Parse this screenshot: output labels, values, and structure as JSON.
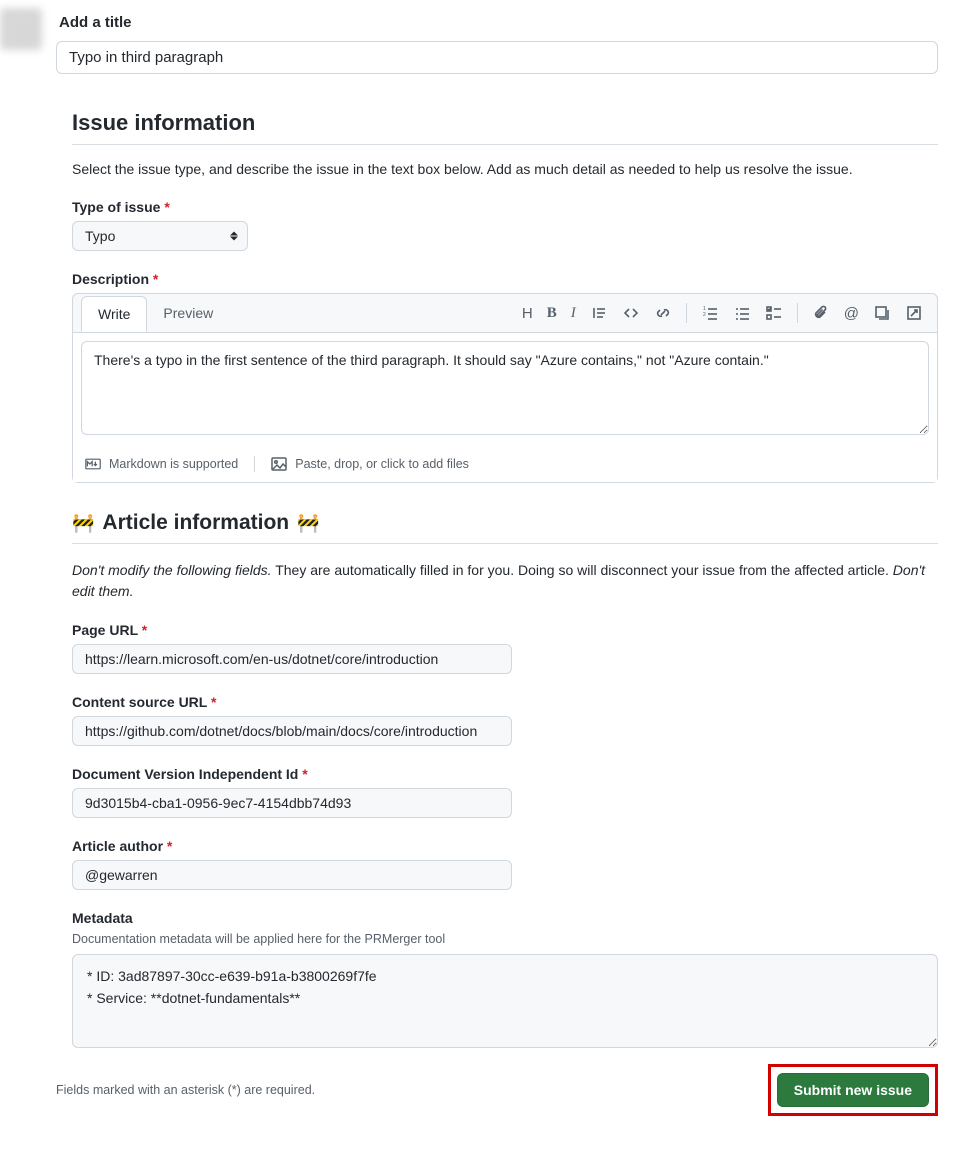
{
  "title_section": {
    "label": "Add a title",
    "value": "Typo in third paragraph"
  },
  "issue_info": {
    "heading": "Issue information",
    "description": "Select the issue type, and describe the issue in the text box below. Add as much detail as needed to help us resolve the issue.",
    "type_label": "Type of issue",
    "type_value": "Typo",
    "description_label": "Description",
    "tabs": {
      "write": "Write",
      "preview": "Preview"
    },
    "body_text": "There's a typo in the first sentence of the third paragraph. It should say \"Azure contains,\" not \"Azure contain.\"",
    "footer_markdown": "Markdown is supported",
    "footer_attach": "Paste, drop, or click to add files"
  },
  "article_info": {
    "heading": "Article information",
    "desc_prefix_em": "Don't modify the following fields.",
    "desc_mid": " They are automatically filled in for you. Doing so will disconnect your issue from the affected article. ",
    "desc_suffix_em": "Don't edit them.",
    "page_url_label": "Page URL",
    "page_url_value": "https://learn.microsoft.com/en-us/dotnet/core/introduction",
    "source_url_label": "Content source URL",
    "source_url_value": "https://github.com/dotnet/docs/blob/main/docs/core/introduction",
    "doc_id_label": "Document Version Independent Id",
    "doc_id_value": "9d3015b4-cba1-0956-9ec7-4154dbb74d93",
    "author_label": "Article author",
    "author_value": "@gewarren",
    "metadata_label": "Metadata",
    "metadata_note": "Documentation metadata will be applied here for the PRMerger tool",
    "metadata_line1": "* ID: 3ad87897-30cc-e639-b91a-b3800269f7fe",
    "metadata_line2": "* Service: **dotnet-fundamentals**"
  },
  "bottom": {
    "required_note": "Fields marked with an asterisk (*) are required.",
    "submit": "Submit new issue"
  }
}
